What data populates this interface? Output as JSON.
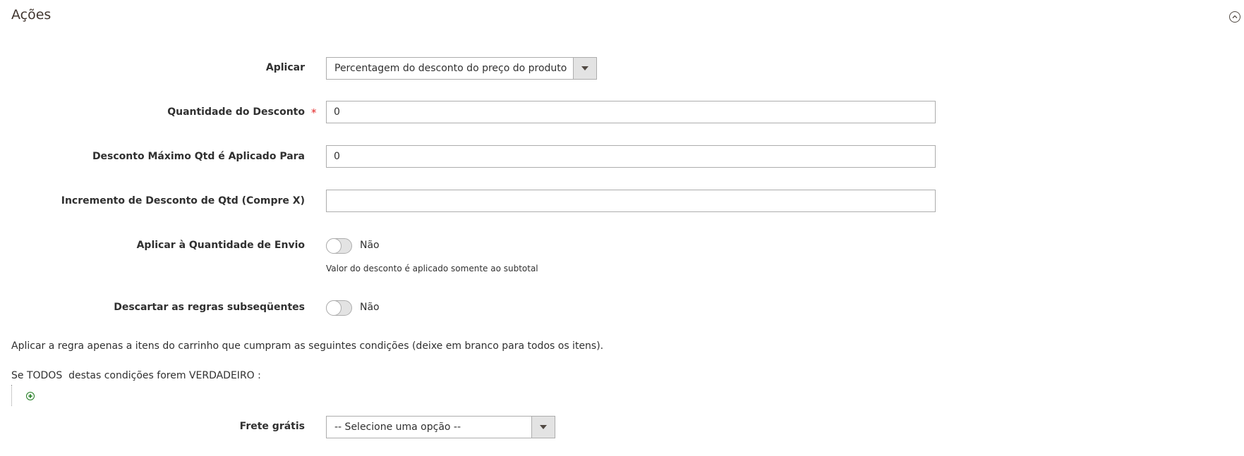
{
  "section": {
    "title": "Ações"
  },
  "fields": {
    "apply": {
      "label": "Aplicar",
      "value": "Percentagem do desconto do preço do produto"
    },
    "discount_amount": {
      "label": "Quantidade do Desconto",
      "required_mark": "*",
      "value": "0"
    },
    "max_qty": {
      "label": "Desconto Máximo Qtd é Aplicado Para",
      "value": "0"
    },
    "step": {
      "label": "Incremento de Desconto de Qtd (Compre X)",
      "value": ""
    },
    "apply_shipping": {
      "label": "Aplicar à Quantidade de Envio",
      "state": "Não",
      "note": "Valor do desconto é aplicado somente ao subtotal"
    },
    "discard_rules": {
      "label": "Descartar as regras subseqüentes",
      "state": "Não"
    },
    "free_shipping": {
      "label": "Frete grátis",
      "value": "-- Selecione uma opção --"
    }
  },
  "conditions": {
    "intro": "Aplicar a regra apenas a itens do carrinho que cumpram as seguintes condições (deixe em branco para todos os itens).",
    "prefix": "Se",
    "aggregator": "TODOS",
    "middle": "destas condições forem",
    "value": "VERDADEIRO",
    "suffix": ":"
  }
}
